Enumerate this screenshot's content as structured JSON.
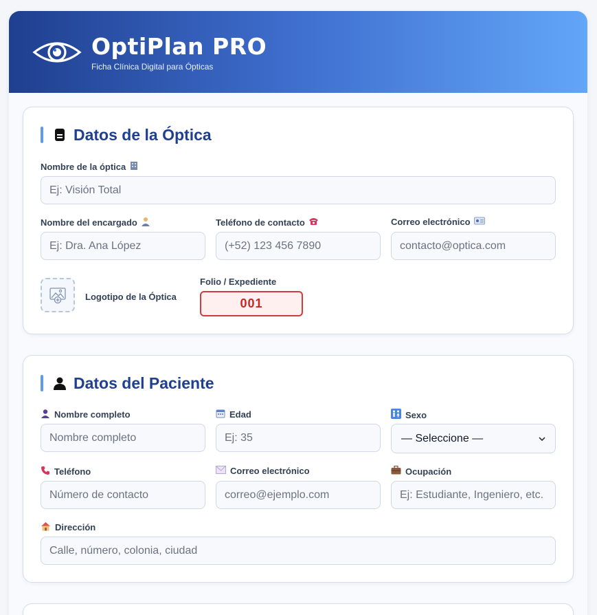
{
  "header": {
    "title": "OptiPlan PRO",
    "subtitle": "Ficha Clínica Digital para Ópticas"
  },
  "optica": {
    "section_title": "Datos de la Óptica",
    "name_label": "Nombre de la óptica",
    "name_placeholder": "Ej: Visión Total",
    "manager_label": "Nombre del encargado",
    "manager_placeholder": "Ej: Dra. Ana López",
    "phone_label": "Teléfono de contacto",
    "phone_placeholder": "(+52) 123 456 7890",
    "email_label": "Correo electrónico",
    "email_placeholder": "contacto@optica.com",
    "logo_label": "Logotipo de la Óptica",
    "folio_label": "Folio / Expediente",
    "folio_value": "001"
  },
  "paciente": {
    "section_title": "Datos del Paciente",
    "fullname_label": "Nombre completo",
    "fullname_placeholder": "Nombre completo",
    "age_label": "Edad",
    "age_placeholder": "Ej: 35",
    "sex_label": "Sexo",
    "sex_selected": "— Seleccione —",
    "phone_label": "Teléfono",
    "phone_placeholder": "Número de contacto",
    "email_label": "Correo electrónico",
    "email_placeholder": "correo@ejemplo.com",
    "occupation_label": "Ocupación",
    "occupation_placeholder": "Ej: Estudiante, Ingeniero, etc.",
    "address_label": "Dirección",
    "address_placeholder": "Calle, número, colonia, ciudad"
  },
  "icons": {
    "brand": "eye-icon",
    "optica_section": "document-icon",
    "paciente_section": "person-icon",
    "name": "office-building-icon",
    "manager": "person-office-worker-icon",
    "phone": "telephone-icon",
    "email": "id-card-icon",
    "patient_name": "bust-silhouette-icon",
    "age": "calendar-icon",
    "sex": "restroom-icon",
    "patient_phone": "phone-receiver-icon",
    "patient_email": "envelope-icon",
    "occupation": "briefcase-icon",
    "address": "house-icon",
    "logo_upload": "image-add-icon"
  },
  "colors": {
    "header_start": "#1f3f8f",
    "header_end": "#62a6f8",
    "section_title": "#1f3f8f",
    "folio_border": "#d23b3b",
    "folio_text": "#c62828"
  }
}
